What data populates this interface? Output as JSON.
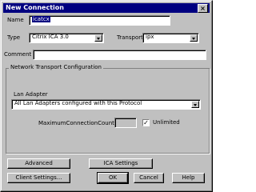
{
  "window": {
    "title": "New Connection",
    "close_icon": "close-icon"
  },
  "form": {
    "name_label": "Name",
    "name_value": "icatcx",
    "type_label": "Type",
    "type_value": "Citrix ICA 3.0",
    "transport_label": "Transport",
    "transport_value": "ipx",
    "comment_label": "Comment",
    "comment_value": ""
  },
  "network": {
    "group_title": "Network Transport Configuration",
    "lan_adapter_label": "Lan Adapter",
    "lan_adapter_value": "All Lan Adapters configured with this Protocol",
    "max_connection_label": "MaximumConnectionCount",
    "max_connection_value": "",
    "unlimited_label": "Unlimited",
    "unlimited_checked": true,
    "unlimited_mark": "✓"
  },
  "buttons": {
    "advanced": "Advanced",
    "ica_settings": "ICA Settings",
    "client_settings": "Client Settings...",
    "ok": "OK",
    "cancel": "Cancel",
    "help": "Help"
  }
}
